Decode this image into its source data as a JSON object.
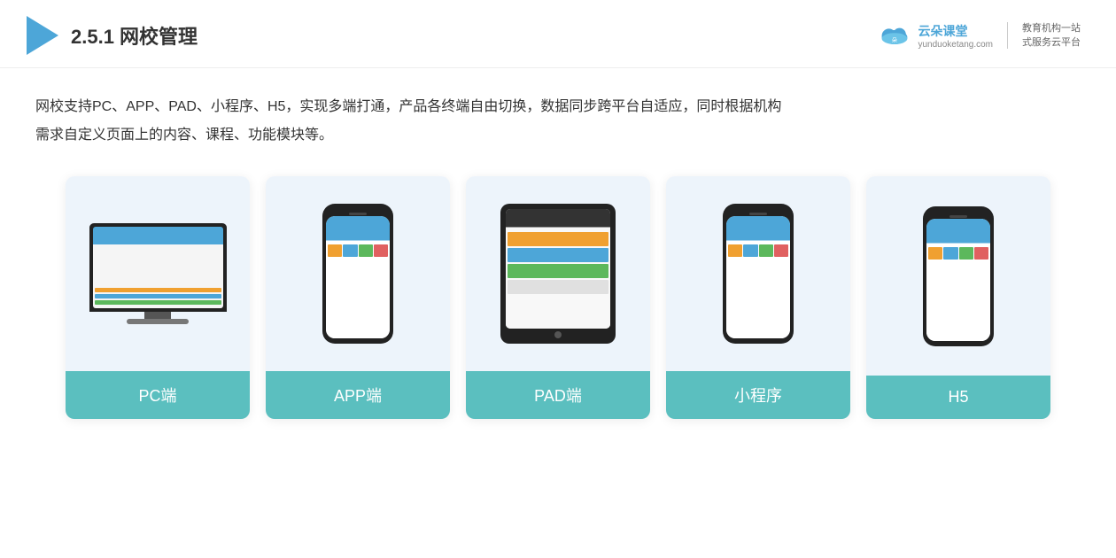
{
  "header": {
    "title_prefix": "2.5.1 ",
    "title_bold": "网校管理",
    "brand_name": "云朵课堂",
    "brand_url": "yunduoketang.com",
    "brand_tagline1": "教育机构一站",
    "brand_tagline2": "式服务云平台"
  },
  "description": {
    "text_line1": "网校支持PC、APP、PAD、小程序、H5，实现多端打通，产品各终端自由切换，数据同步跨平台自适应，同时根据机构",
    "text_line2": "需求自定义页面上的内容、课程、功能模块等。"
  },
  "cards": [
    {
      "id": "pc",
      "label": "PC端"
    },
    {
      "id": "app",
      "label": "APP端"
    },
    {
      "id": "pad",
      "label": "PAD端"
    },
    {
      "id": "mini",
      "label": "小程序"
    },
    {
      "id": "h5",
      "label": "H5"
    }
  ]
}
